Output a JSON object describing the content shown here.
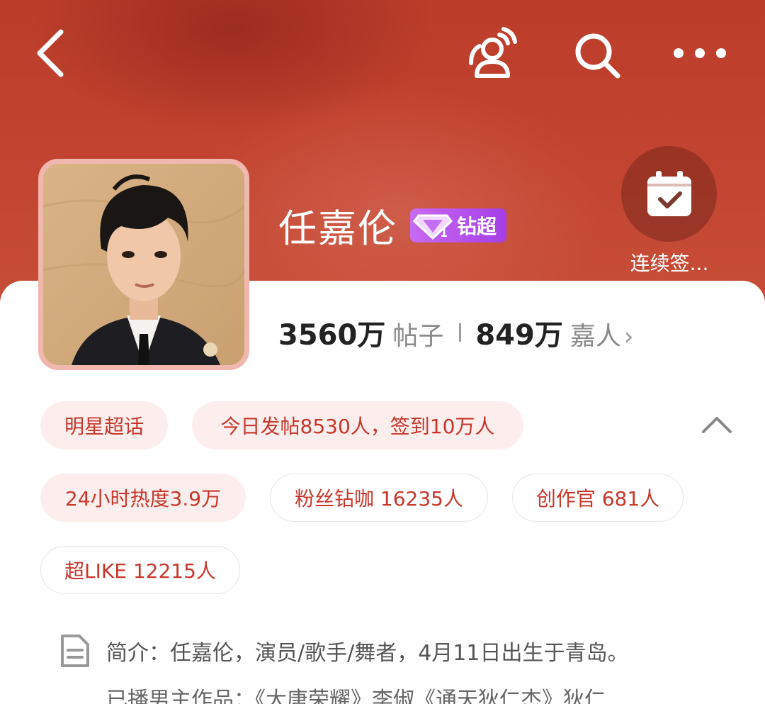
{
  "header": {
    "back_icon": "chevron-left-icon",
    "people_icon": "people-icon",
    "search_icon": "search-icon",
    "more_icon": "more-dots-icon"
  },
  "profile": {
    "name": "任嘉伦",
    "badge_label": "钻超",
    "checkin_label": "连续签..."
  },
  "stats": {
    "posts_count": "3560万",
    "posts_label": "帖子",
    "fans_count": "849万",
    "fans_label": "嘉人",
    "arrow": "›"
  },
  "tags": {
    "category": "明星超话",
    "today": "今日发帖8530人，签到10万人",
    "heat": "24小时热度3.9万",
    "diamond_fans": "粉丝钻咖 16235人",
    "creators": "创作官 681人",
    "super_like": "超LIKE 12215人"
  },
  "intro": {
    "line1": "简介：任嘉伦，演员/歌手/舞者，4月11日出生于青岛。",
    "line2": "已播男主作品：《大唐荣耀》李俶《通天狄仁杰》狄仁"
  },
  "colors": {
    "accent": "#c8372b",
    "header_bg": "#c2432f",
    "badge": "#b04ae8"
  }
}
